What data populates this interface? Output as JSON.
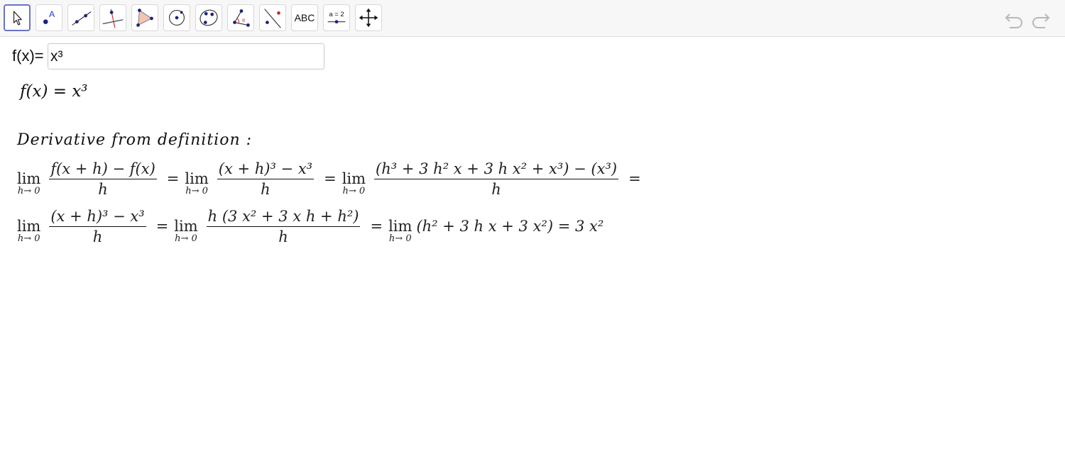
{
  "toolbar": {
    "text_tool_label": "ABC",
    "slider_tool_label": "a = 2"
  },
  "input": {
    "label": "f(x)=",
    "value": "x³"
  },
  "content": {
    "function_line": "f(x) = x³",
    "derivative_heading": "Derivative from definition :",
    "row1": {
      "lim_label": "lim",
      "lim_sub": "h→ 0",
      "frac1_num": "f(x + h) − f(x)",
      "frac1_den": "h",
      "eq": "=",
      "frac2_num": "(x + h)³ − x³",
      "frac2_den": "h",
      "frac3_num": "(h³ + 3 h² x + 3 h x² + x³) − (x³)",
      "frac3_den": "h"
    },
    "row2": {
      "lim_label": "lim",
      "lim_sub": "h→ 0",
      "frac1_num": "(x + h)³ − x³",
      "frac1_den": "h",
      "eq": "=",
      "frac2_num": "h  (3 x² + 3 x h + h²)",
      "frac2_den": "h",
      "expr": "(h² + 3 h x + 3 x²) = 3 x²"
    }
  },
  "colors": {
    "accent": "#6b73c6",
    "point_blue": "#1a237e",
    "line_red": "#c62828"
  }
}
